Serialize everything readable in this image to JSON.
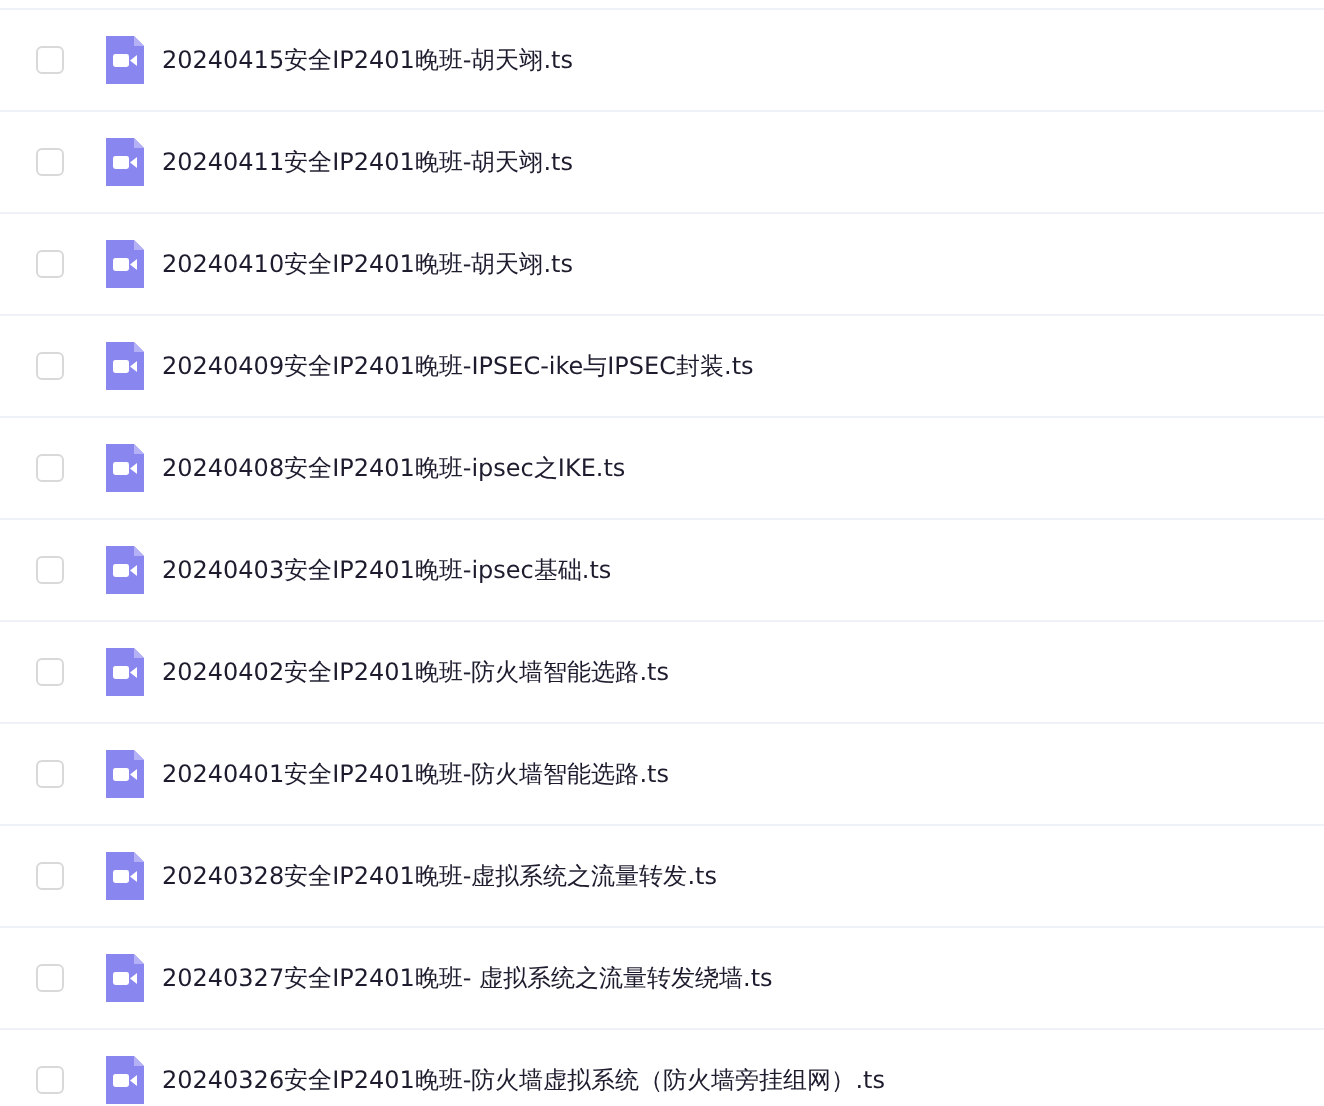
{
  "files": [
    {
      "name": "20240415安全IP2401晚班-胡天翊.ts",
      "checked": false
    },
    {
      "name": "20240411安全IP2401晚班-胡天翊.ts",
      "checked": false
    },
    {
      "name": "20240410安全IP2401晚班-胡天翊.ts",
      "checked": false
    },
    {
      "name": "20240409安全IP2401晚班-IPSEC-ike与IPSEC封装.ts",
      "checked": false
    },
    {
      "name": "20240408安全IP2401晚班-ipsec之IKE.ts",
      "checked": false
    },
    {
      "name": "20240403安全IP2401晚班-ipsec基础.ts",
      "checked": false
    },
    {
      "name": "20240402安全IP2401晚班-防火墙智能选路.ts",
      "checked": false
    },
    {
      "name": "20240401安全IP2401晚班-防火墙智能选路.ts",
      "checked": false
    },
    {
      "name": "20240328安全IP2401晚班-虚拟系统之流量转发.ts",
      "checked": false
    },
    {
      "name": "20240327安全IP2401晚班- 虚拟系统之流量转发绕墙.ts",
      "checked": false
    },
    {
      "name": "20240326安全IP2401晚班-防火墙虚拟系统（防火墙旁挂组网）.ts",
      "checked": false
    }
  ]
}
